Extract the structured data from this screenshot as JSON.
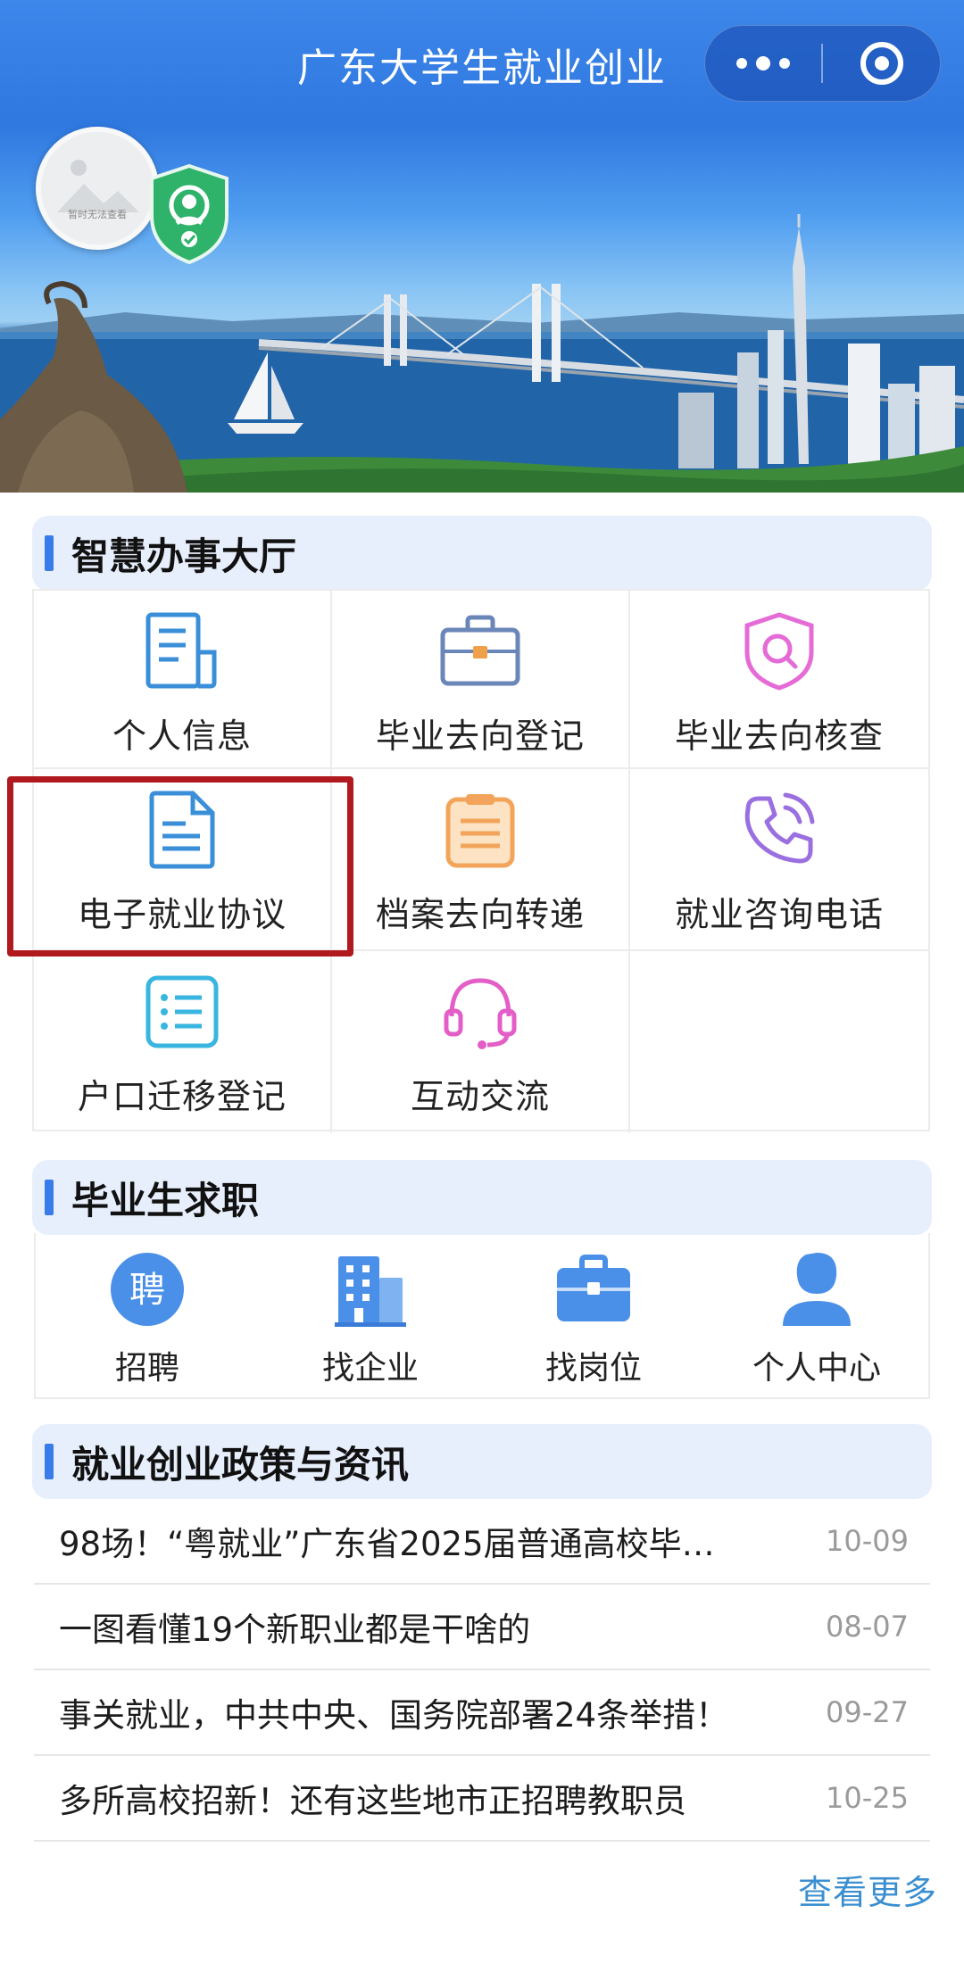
{
  "header": {
    "title": "广东大学生就业创业"
  },
  "avatar": {
    "caption": "暂时无法查看"
  },
  "service_hall": {
    "title": "智慧办事大厅",
    "items": [
      {
        "label": "个人信息",
        "icon": "document-icon"
      },
      {
        "label": "毕业去向登记",
        "icon": "briefcase-icon"
      },
      {
        "label": "毕业去向核查",
        "icon": "shield-search-icon"
      },
      {
        "label": "电子就业协议",
        "icon": "file-text-icon"
      },
      {
        "label": "档案去向转递",
        "icon": "clipboard-icon"
      },
      {
        "label": "就业咨询电话",
        "icon": "phone-icon"
      },
      {
        "label": "户口迁移登记",
        "icon": "list-icon"
      },
      {
        "label": "互动交流",
        "icon": "headset-icon"
      }
    ]
  },
  "job_seeking": {
    "title": "毕业生求职",
    "recruit_glyph": "聘",
    "items": [
      {
        "label": "招聘",
        "icon": "recruit-icon"
      },
      {
        "label": "找企业",
        "icon": "building-icon"
      },
      {
        "label": "找岗位",
        "icon": "briefcase-icon"
      },
      {
        "label": "个人中心",
        "icon": "user-icon"
      }
    ]
  },
  "news": {
    "title": "就业创业政策与资讯",
    "items": [
      {
        "title": "98场！“粤就业”广东省2025届普通高校毕…",
        "date": "10-09"
      },
      {
        "title": "一图看懂19个新职业都是干啥的",
        "date": "08-07"
      },
      {
        "title": "事关就业，中共中央、国务院部署24条举措！",
        "date": "09-27"
      },
      {
        "title": "多所高校招新！还有这些地市正招聘教职员",
        "date": "10-25"
      }
    ],
    "more_label": "查看更多"
  },
  "colors": {
    "accent": "#3a7bea",
    "section_bg": "#e8effc",
    "highlight": "#b0191e",
    "more_link": "#3b8fd0"
  }
}
